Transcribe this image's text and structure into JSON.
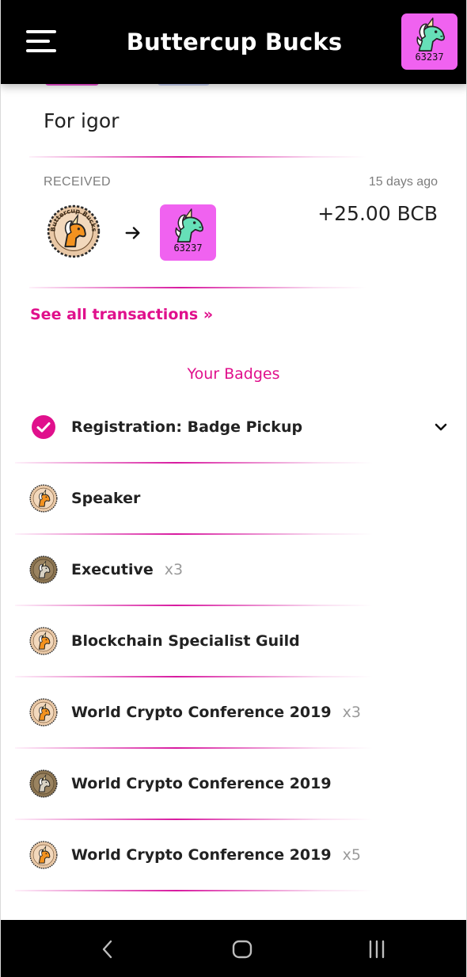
{
  "app": {
    "title": "Buttercup Bucks"
  },
  "header": {
    "menu_icon": "hamburger-menu-icon",
    "avatar": {
      "icon": "unicorn-avatar-icon",
      "id": "63237",
      "bg": "#f062f0"
    }
  },
  "colors": {
    "accent": "#e0108c",
    "appbar": "#000000",
    "avatar_bg": "#f062f0"
  },
  "transaction": {
    "memo": "For igor",
    "status": "RECEIVED",
    "time": "15 days ago",
    "amount": "+25.00 BCB",
    "from_icon": "buttercup-coin-icon",
    "from_coin_text": "Buttercup Bucks",
    "arrow_icon": "arrow-right-icon",
    "to_avatar_id": "63237"
  },
  "links": {
    "see_all": "See all transactions »"
  },
  "badges": {
    "title": "Your Badges",
    "items": [
      {
        "label": "Registration: Badge Pickup",
        "count": "",
        "icon": "check-circle-icon"
      },
      {
        "label": "Speaker",
        "count": "",
        "icon": "coin-badge-icon"
      },
      {
        "label": "Executive",
        "count": "x3",
        "icon": "coin-badge-dark-icon"
      },
      {
        "label": "Blockchain Specialist Guild",
        "count": "",
        "icon": "coin-badge-icon"
      },
      {
        "label": "World Crypto Conference 2019",
        "count": "x3",
        "icon": "coin-badge-icon"
      },
      {
        "label": "World Crypto Conference 2019",
        "count": "",
        "icon": "coin-badge-dark-icon"
      },
      {
        "label": "World Crypto Conference 2019",
        "count": "x5",
        "icon": "coin-badge-icon"
      }
    ]
  },
  "system_nav": {
    "back": "back-icon",
    "home": "home-icon",
    "recents": "recents-icon"
  }
}
